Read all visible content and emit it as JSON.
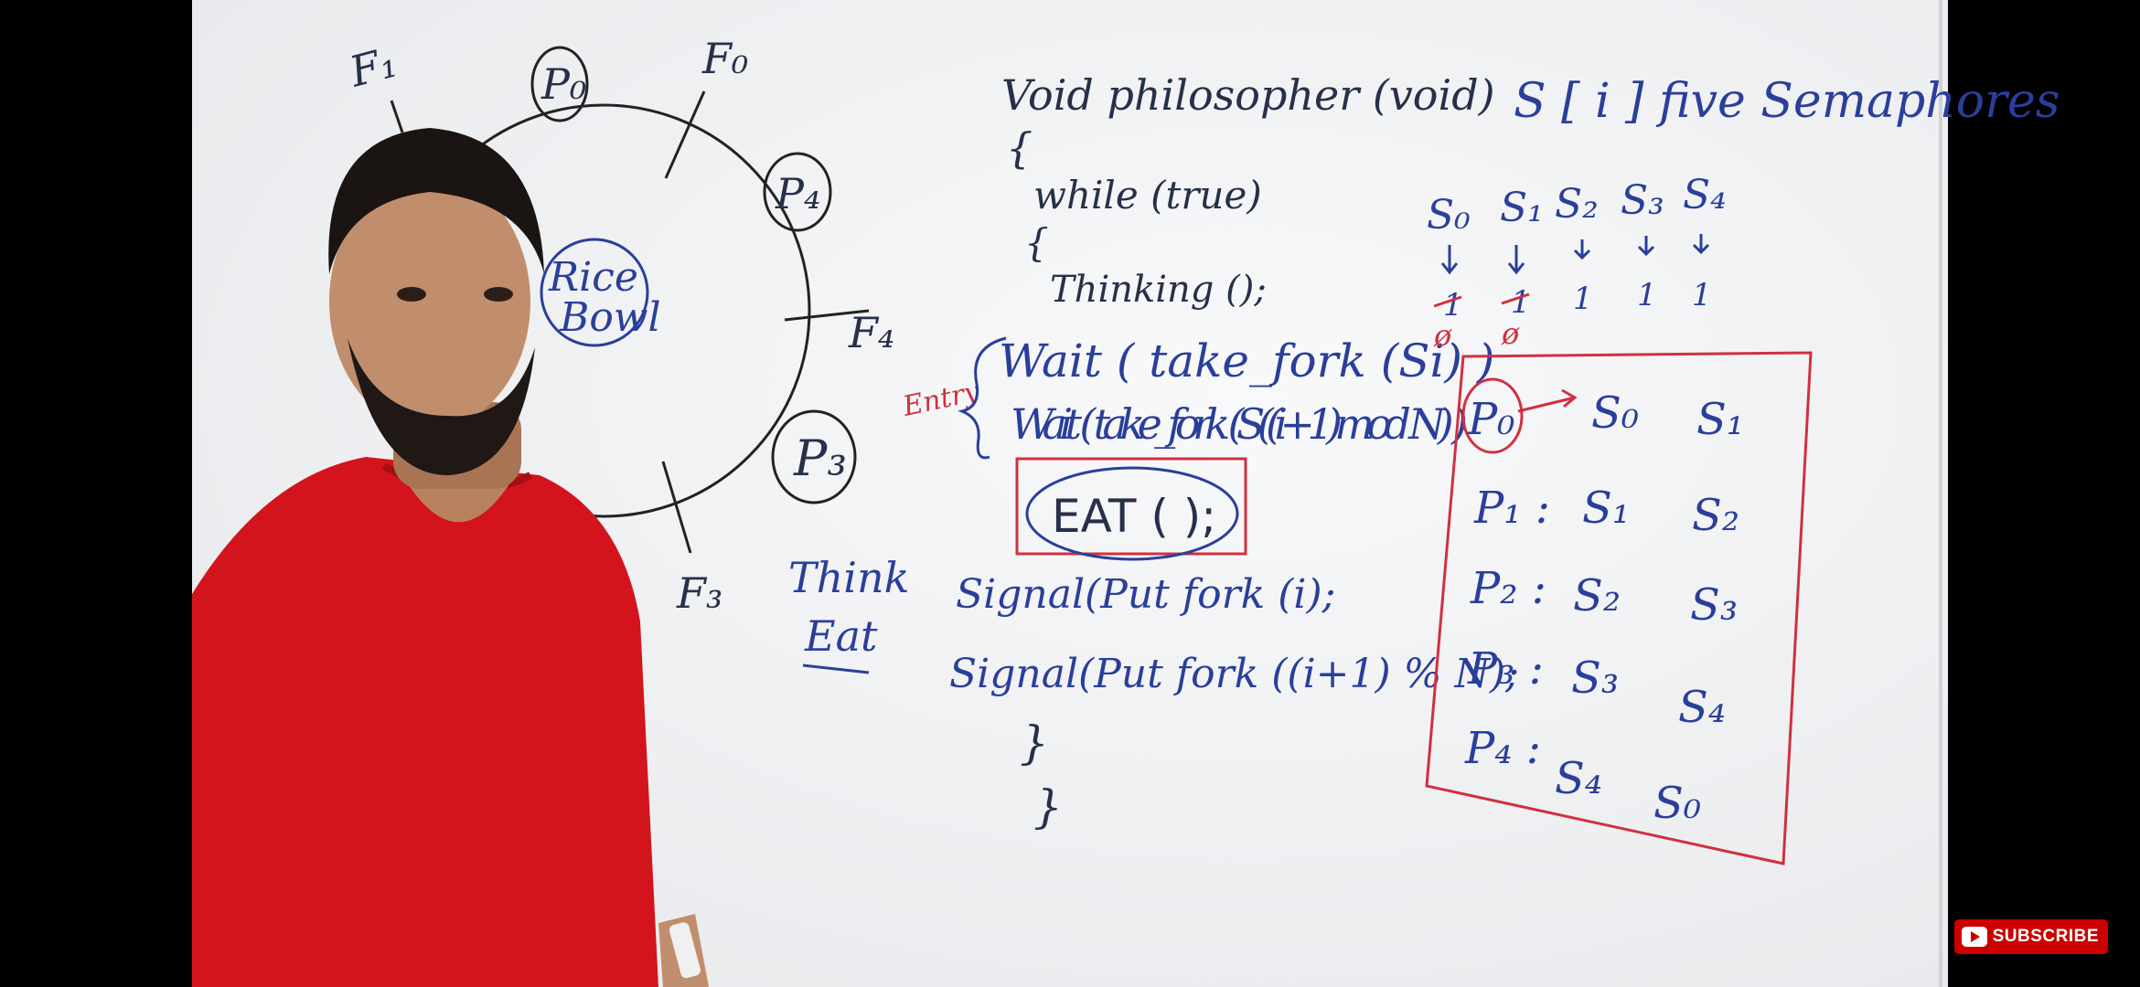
{
  "player": {
    "subscribe_label": "SUBSCRIBE",
    "subscribe_icon": "youtube-play-icon"
  },
  "board": {
    "circle_labels": [
      "F₁",
      "P₀",
      "F₀",
      "P₄",
      "F₄",
      "P₃",
      "F₃"
    ],
    "rice_bowl": [
      "Rice",
      "Bowl"
    ],
    "think": "Think",
    "eat": "Eat",
    "code": {
      "signature": "Void philosopher (void)",
      "brace_open": "{",
      "while": "while (true)",
      "brace_open2": "{",
      "thinking": "Thinking ();",
      "entry_label": "Entry",
      "wait1": "Wait ( take_fork (Si) )",
      "wait2": "Wait ( take_fork (S((i+1)mod N) )",
      "eat": "EAT ( );",
      "signal1": "Signal(Put fork (i);",
      "signal2": "Signal(Put fork ((i+1) % N);",
      "brace_close1": "}",
      "brace_close2": "}"
    },
    "semaphore_title": "S [ i ]  five Semaphores",
    "semaphores": [
      "S₀",
      "S₁",
      "S₂",
      "S₃",
      "S₄"
    ],
    "semaphore_values": [
      "1",
      "1",
      "1",
      "1",
      "1"
    ],
    "semaphore_zero_values": [
      "ø",
      "ø"
    ],
    "table_rows": [
      {
        "p": "P₀",
        "left": "S₀",
        "right": "S₁"
      },
      {
        "p": "P₁ :",
        "left": "S₁",
        "right": "S₂"
      },
      {
        "p": "P₂ :",
        "left": "S₂",
        "right": "S₃"
      },
      {
        "p": "P₃ :",
        "left": "S₃",
        "right": "S₄"
      },
      {
        "p": "P₄ :",
        "left": "S₄",
        "right": "S₀"
      }
    ]
  }
}
